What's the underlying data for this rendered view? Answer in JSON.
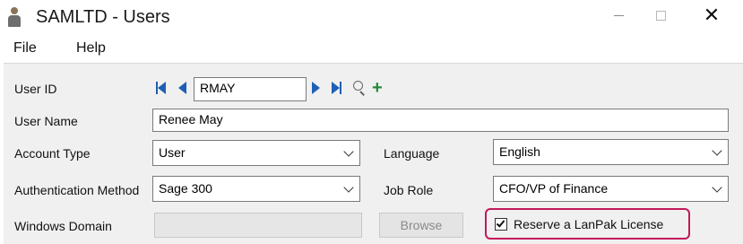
{
  "window": {
    "title": "SAMLTD - Users",
    "close_glyph": "✕"
  },
  "menu": {
    "items": [
      "File",
      "Help"
    ]
  },
  "form": {
    "user_id": {
      "label": "User ID",
      "value": "RMAY"
    },
    "user_name": {
      "label": "User Name",
      "value": "Renee May"
    },
    "account_type": {
      "label": "Account Type",
      "value": "User"
    },
    "language": {
      "label": "Language",
      "value": "English"
    },
    "auth_method": {
      "label": "Authentication Method",
      "value": "Sage 300"
    },
    "job_role": {
      "label": "Job Role",
      "value": "CFO/VP of Finance"
    },
    "windows_domain": {
      "label": "Windows Domain",
      "value": ""
    },
    "browse_button": "Browse",
    "reserve_license": {
      "label": "Reserve a LanPak License",
      "checked": true
    }
  },
  "icons": {
    "first": "first-record-icon",
    "previous": "previous-record-icon",
    "next": "next-record-icon",
    "last": "last-record-icon",
    "finder": "zoom-finder-icon",
    "new": "add-new-icon"
  },
  "colors": {
    "nav_blue": "#1f5fb5",
    "add_green": "#1f8a3a",
    "highlight": "#c2185b",
    "panel": "#f0f0f0"
  }
}
